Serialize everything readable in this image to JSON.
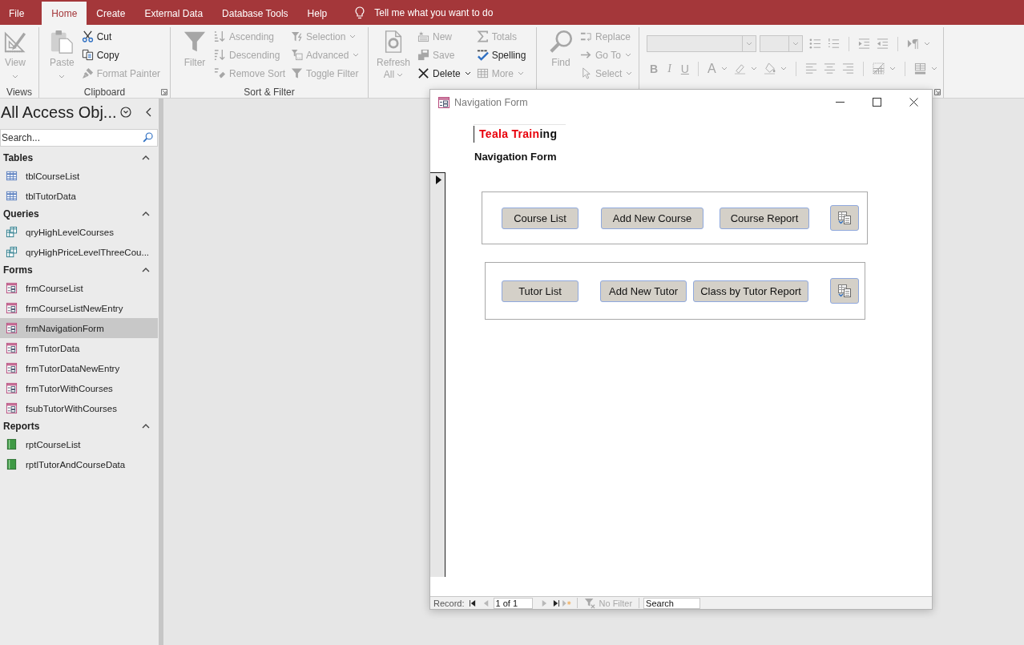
{
  "title_bar": {
    "tabs": [
      {
        "label": "File",
        "selected": false
      },
      {
        "label": "Home",
        "selected": true
      },
      {
        "label": "Create",
        "selected": false
      },
      {
        "label": "External Data",
        "selected": false
      },
      {
        "label": "Database Tools",
        "selected": false
      },
      {
        "label": "Help",
        "selected": false
      }
    ],
    "tell_me": {
      "placeholder": "Tell me what you want to do"
    }
  },
  "ribbon": {
    "groups": [
      {
        "label": "Views",
        "items": [
          {
            "kind": "split",
            "label": "View",
            "disabled": true,
            "dropdown": true
          }
        ]
      },
      {
        "label": "Clipboard",
        "launcher": true,
        "items": [
          {
            "kind": "split",
            "label": "Paste",
            "disabled": true,
            "dropdown": true
          },
          {
            "kind": "small",
            "label": "Cut",
            "disabled": false
          },
          {
            "kind": "small",
            "label": "Copy",
            "disabled": false
          },
          {
            "kind": "small",
            "label": "Format Painter",
            "disabled": true
          }
        ]
      },
      {
        "label": "Sort & Filter",
        "items": [
          {
            "kind": "large",
            "label": "Filter",
            "disabled": true
          },
          {
            "kind": "small",
            "label": "Ascending",
            "disabled": true
          },
          {
            "kind": "small",
            "label": "Descending",
            "disabled": true
          },
          {
            "kind": "small",
            "label": "Remove Sort",
            "disabled": true
          },
          {
            "kind": "small",
            "label": "Selection",
            "disabled": true,
            "dropdown": true
          },
          {
            "kind": "small",
            "label": "Advanced",
            "disabled": true,
            "dropdown": true
          },
          {
            "kind": "small",
            "label": "Toggle Filter",
            "disabled": true
          }
        ]
      },
      {
        "items": [
          {
            "kind": "large",
            "label": "Refresh All",
            "disabled": true,
            "dropdown": true
          },
          {
            "kind": "small",
            "label": "New",
            "disabled": true
          },
          {
            "kind": "small",
            "label": "Save",
            "disabled": true
          },
          {
            "kind": "small",
            "label": "Delete",
            "disabled": false,
            "dropdown": true
          },
          {
            "kind": "small",
            "label": "Totals",
            "disabled": true
          },
          {
            "kind": "small",
            "label": "Spelling",
            "disabled": false
          },
          {
            "kind": "small",
            "label": "More",
            "disabled": true,
            "dropdown": true
          }
        ]
      },
      {
        "items": [
          {
            "kind": "large",
            "label": "Find",
            "disabled": true
          },
          {
            "kind": "small",
            "label": "Replace",
            "disabled": true
          },
          {
            "kind": "small",
            "label": "Go To",
            "disabled": true,
            "dropdown": true
          },
          {
            "kind": "small",
            "label": "Select",
            "disabled": true,
            "dropdown": true
          }
        ]
      },
      {
        "launcher": true,
        "rows": [
          [
            {
              "kind": "combo",
              "disabled": true
            },
            {
              "kind": "combo",
              "disabled": true
            },
            {
              "kind": "tool",
              "disabled": true
            },
            {
              "kind": "tool",
              "disabled": true
            },
            {
              "kind": "separator"
            },
            {
              "kind": "tool",
              "disabled": true
            },
            {
              "kind": "tool",
              "disabled": true
            },
            {
              "kind": "separator"
            },
            {
              "kind": "tool",
              "disabled": true,
              "dropdown": true
            }
          ],
          [
            {
              "kind": "tool",
              "label": "B",
              "disabled": true
            },
            {
              "kind": "tool",
              "label": "I",
              "disabled": true
            },
            {
              "kind": "tool",
              "label": "U",
              "disabled": true
            },
            {
              "kind": "separator"
            },
            {
              "kind": "tool",
              "label": "A",
              "disabled": true,
              "dropdown": true
            },
            {
              "kind": "tool",
              "disabled": true,
              "dropdown": true
            },
            {
              "kind": "tool",
              "disabled": true,
              "dropdown": true
            },
            {
              "kind": "separator"
            },
            {
              "kind": "tool",
              "disabled": true
            },
            {
              "kind": "tool",
              "disabled": true
            },
            {
              "kind": "tool",
              "disabled": true
            },
            {
              "kind": "separator"
            },
            {
              "kind": "tool",
              "disabled": true,
              "dropdown": true
            },
            {
              "kind": "separator"
            },
            {
              "kind": "tool",
              "disabled": true,
              "dropdown": true
            }
          ]
        ]
      }
    ]
  },
  "nav_pane": {
    "title": "All Access Obj...",
    "search": {
      "placeholder": "Search..."
    },
    "groups": [
      {
        "label": "Tables",
        "expanded": true,
        "items": [
          {
            "label": "tblCourseList",
            "kind": "table",
            "selected": false
          },
          {
            "label": "tblTutorData",
            "kind": "table",
            "selected": false
          }
        ]
      },
      {
        "label": "Queries",
        "expanded": true,
        "items": [
          {
            "label": "qryHighLevelCourses",
            "kind": "query",
            "selected": false
          },
          {
            "label": "qryHighPriceLevelThreeCou...",
            "kind": "query",
            "selected": false
          }
        ]
      },
      {
        "label": "Forms",
        "expanded": true,
        "items": [
          {
            "label": "frmCourseList",
            "kind": "form",
            "selected": false
          },
          {
            "label": "frmCourseListNewEntry",
            "kind": "form",
            "selected": false
          },
          {
            "label": "frmNavigationForm",
            "kind": "form",
            "selected": true
          },
          {
            "label": "frmTutorData",
            "kind": "form",
            "selected": false
          },
          {
            "label": "frmTutorDataNewEntry",
            "kind": "form",
            "selected": false
          },
          {
            "label": "frmTutorWithCourses",
            "kind": "form",
            "selected": false
          },
          {
            "label": "fsubTutorWithCourses",
            "kind": "form",
            "selected": false
          }
        ]
      },
      {
        "label": "Reports",
        "expanded": true,
        "items": [
          {
            "label": "rptCourseList",
            "kind": "report",
            "selected": false
          },
          {
            "label": "rptlTutorAndCourseData",
            "kind": "report",
            "selected": false
          }
        ]
      }
    ]
  },
  "form_window": {
    "title": "Navigation Form",
    "logo": [
      {
        "text": "Teala Train",
        "color": "#e8000b"
      },
      {
        "text": "ing",
        "color": "#111111"
      }
    ],
    "heading": "Navigation Form",
    "button_groups": [
      {
        "buttons": [
          {
            "kind": "text",
            "label": "Course List"
          },
          {
            "kind": "text",
            "label": "Add New Course"
          },
          {
            "kind": "text",
            "label": "Course Report"
          },
          {
            "kind": "icon"
          }
        ]
      },
      {
        "buttons": [
          {
            "kind": "text",
            "label": "Tutor List"
          },
          {
            "kind": "text",
            "label": "Add New Tutor"
          },
          {
            "kind": "text",
            "label": "Class by Tutor Report"
          },
          {
            "kind": "icon"
          }
        ]
      }
    ],
    "record_bar": {
      "label": "Record:",
      "nav_buttons": [
        {
          "disabled": false
        },
        {
          "disabled": true
        },
        {
          "disabled": true
        },
        {
          "disabled": false
        },
        {
          "disabled": true
        }
      ],
      "position": "1 of 1",
      "filter": {
        "label": "No Filter",
        "disabled": true
      },
      "search": {
        "placeholder": "Search"
      }
    }
  }
}
